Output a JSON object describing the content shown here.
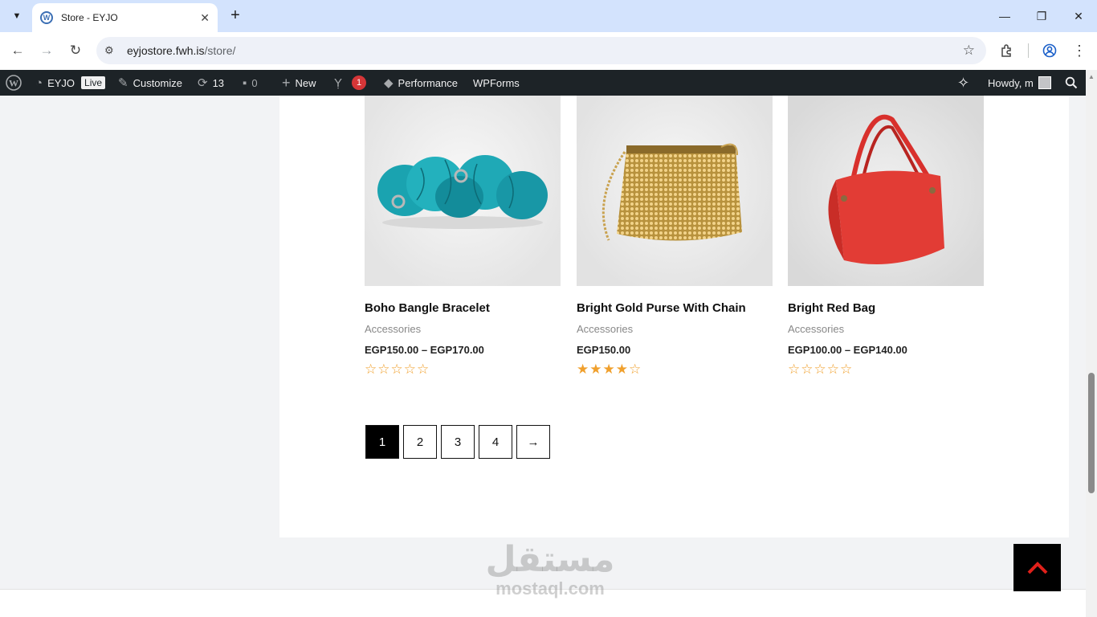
{
  "browser": {
    "tab_title": "Store - EYJO",
    "url_host": "eyjostore.fwh.is",
    "url_path": "/store/"
  },
  "adminbar": {
    "site_name": "EYJO",
    "live_label": "Live",
    "customize": "Customize",
    "updates_count": "13",
    "comments_count": "0",
    "new_label": "New",
    "yoast_badge": "1",
    "performance": "Performance",
    "wpforms": "WPForms",
    "howdy": "Howdy, m"
  },
  "products": [
    {
      "name": "Boho Bangle Bracelet",
      "category": "Accessories",
      "price": "EGP150.00 – EGP170.00",
      "rating": 0
    },
    {
      "name": "Bright Gold Purse With Chain",
      "category": "Accessories",
      "price": "EGP150.00",
      "rating": 4
    },
    {
      "name": "Bright Red Bag",
      "category": "Accessories",
      "price": "EGP100.00 – EGP140.00",
      "rating": 0
    }
  ],
  "pagination": {
    "pages": [
      "1",
      "2",
      "3",
      "4"
    ],
    "current": "1",
    "next": "→"
  },
  "watermark": {
    "arabic": "مستقل",
    "latin": "mostaql.com"
  }
}
